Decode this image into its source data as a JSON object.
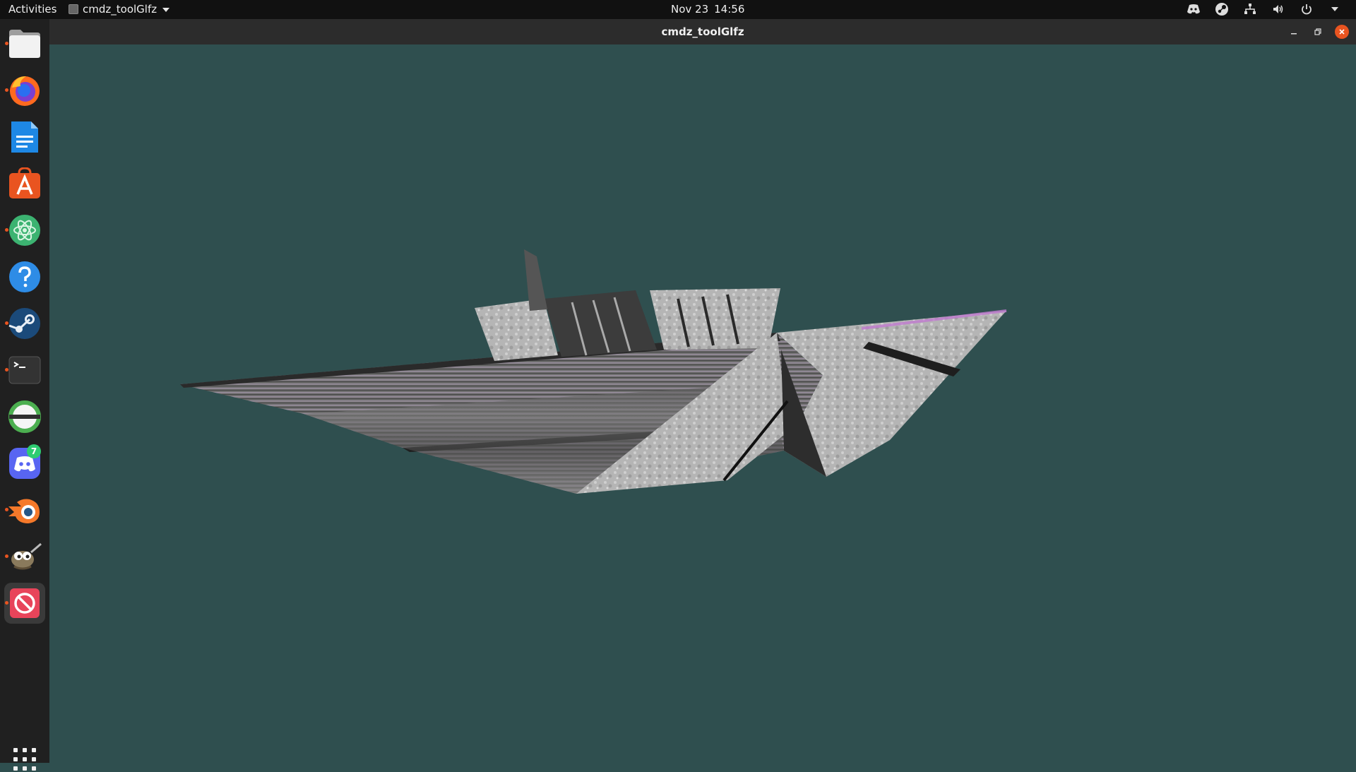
{
  "topbar": {
    "activities_label": "Activities",
    "app_name": "cmdz_toolGlfz",
    "date": "Nov 23",
    "time": "14:56"
  },
  "dock": {
    "apps": [
      {
        "name": "files-icon",
        "running": true
      },
      {
        "name": "firefox-icon",
        "running": true
      },
      {
        "name": "libreoffice-writer-icon",
        "running": false
      },
      {
        "name": "software-store-icon",
        "running": false
      },
      {
        "name": "atom-editor-icon",
        "running": true
      },
      {
        "name": "help-icon",
        "running": false
      },
      {
        "name": "steam-icon",
        "running": true
      },
      {
        "name": "terminal-icon",
        "running": true
      },
      {
        "name": "sync-app-icon",
        "running": false
      },
      {
        "name": "discord-icon",
        "running": false,
        "badge": "7"
      },
      {
        "name": "blender-icon",
        "running": true
      },
      {
        "name": "gimp-icon",
        "running": true
      },
      {
        "name": "cmdz-toolglfz-icon",
        "running": true,
        "active": true
      }
    ]
  },
  "window": {
    "title": "cmdz_toolGlfz",
    "background_color": "#2f4f4f"
  },
  "colors": {
    "accent": "#e95420",
    "close_button": "#e95420",
    "badge": "#2ecc71"
  }
}
